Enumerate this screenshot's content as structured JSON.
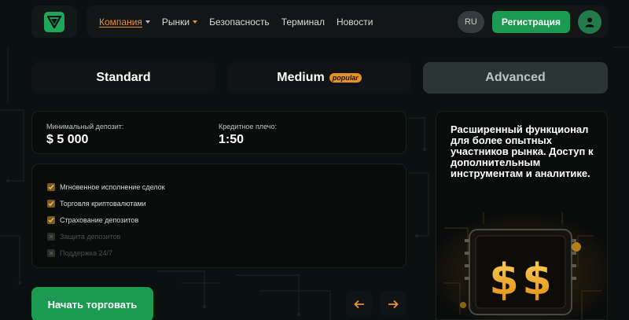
{
  "nav": {
    "items": [
      {
        "label": "Компания",
        "active": true,
        "has_caret": true
      },
      {
        "label": "Рынки",
        "active": false,
        "has_caret": true
      },
      {
        "label": "Безопасность",
        "active": false,
        "has_caret": false
      },
      {
        "label": "Терминал",
        "active": false,
        "has_caret": false
      },
      {
        "label": "Новости",
        "active": false,
        "has_caret": false
      }
    ],
    "lang": "RU",
    "register_label": "Регистрация"
  },
  "tabs": {
    "standard": "Standard",
    "medium": "Medium",
    "medium_badge": "popular",
    "advanced": "Advanced"
  },
  "deposit": {
    "min_label": "Минимальный депозит:",
    "min_value": "$ 5 000",
    "leverage_label": "Кредитное плечо:",
    "leverage_value": "1:50"
  },
  "features": [
    {
      "label": "Мгновенное исполнение сделок",
      "enabled": true
    },
    {
      "label": "Торговля криптовалютами",
      "enabled": true
    },
    {
      "label": "Страхование депозитов",
      "enabled": true
    },
    {
      "label": "Защита депозитов",
      "enabled": false
    },
    {
      "label": "Поддержка 24/7",
      "enabled": false
    }
  ],
  "advanced_description": "Расширенный функционал для более опытных участников рынка. Доступ к дополнительным инструментам и аналитике.",
  "start_button": "Начать торговать",
  "colors": {
    "accent_green": "#1c9a51",
    "accent_orange": "#e8913a",
    "background": "#0b1010"
  },
  "icons": {
    "logo": "v-logo-icon",
    "avatar": "user-icon",
    "prev": "arrow-left-icon",
    "next": "arrow-right-icon",
    "check": "check-icon"
  }
}
